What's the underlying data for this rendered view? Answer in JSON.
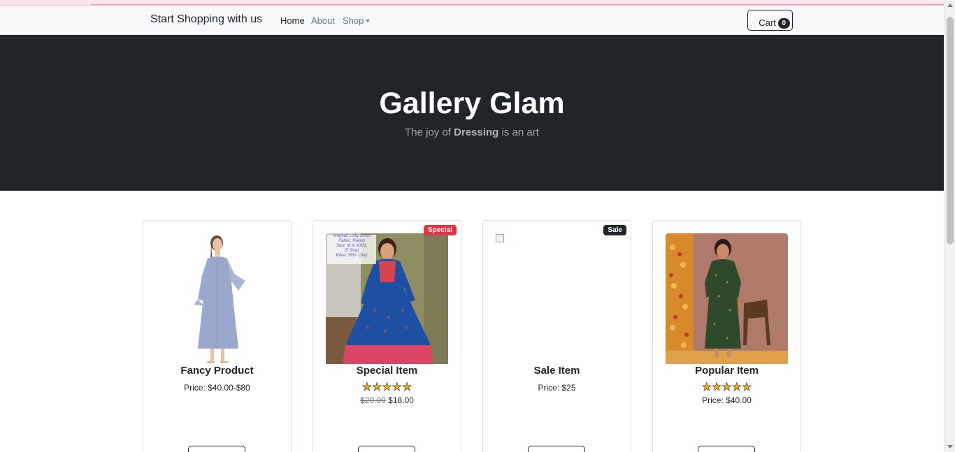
{
  "navbar": {
    "brand": "Start Shopping with us",
    "links": [
      {
        "label": "Home",
        "active": true
      },
      {
        "label": "About",
        "active": false
      },
      {
        "label": "Shop",
        "active": false,
        "dropdown": true
      }
    ],
    "cart": {
      "label": "Cart",
      "count": "0",
      "icon": "cart-icon"
    }
  },
  "hero": {
    "title": "Gallery Glam",
    "subtitle_pre": "The joy of ",
    "subtitle_bold": "Dressing",
    "subtitle_post": " is an art"
  },
  "products": [
    {
      "name": "Fancy Product",
      "price": "Price: $40.00-$80",
      "badge": null,
      "rating": null,
      "image": "light-blue-dress-image"
    },
    {
      "name": "Special Item",
      "badge": "Special",
      "badge_color": "#dc3545",
      "rating": 5,
      "old_price": "$20.00",
      "new_price": "$18.00",
      "image": "blue-anarkali-gown-image",
      "image_caption": [
        "Anarkali Long Gown",
        "Fabric: Rayon",
        "Size: M to XXXL",
        "(5 Size)",
        "Price: 395/- Only"
      ]
    },
    {
      "name": "Sale Item",
      "price": "Price: $25",
      "badge": "Sale",
      "badge_color": "#212529",
      "rating": null,
      "image": "broken-image-icon"
    },
    {
      "name": "Popular Item",
      "price": "Price: $40.00",
      "badge": null,
      "rating": 5,
      "image": "green-kurta-image"
    }
  ],
  "colors": {
    "hero_bg": "#212529",
    "navbar_bg": "#f8f9fa",
    "star": "#f2b01e",
    "special_badge": "#dc3545"
  }
}
